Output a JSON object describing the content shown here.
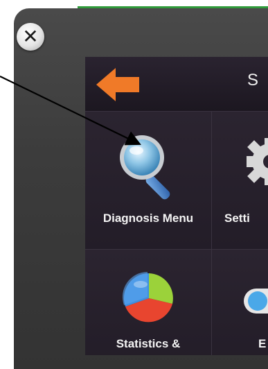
{
  "window": {
    "close_glyph": "✕"
  },
  "header": {
    "title": "S",
    "back_icon": "back-arrow-icon"
  },
  "tiles": [
    {
      "label": "Diagnosis Menu",
      "icon": "magnifier-icon"
    },
    {
      "label": "Setti",
      "icon": "gear-icon"
    },
    {
      "label": "Statistics &",
      "icon": "pie-chart-icon"
    },
    {
      "label": "E",
      "icon": "toggle-icon"
    }
  ],
  "colors": {
    "back_arrow": "#f07a28",
    "screen_bg": "#201a26",
    "accent_green": "#2f9a3a"
  }
}
